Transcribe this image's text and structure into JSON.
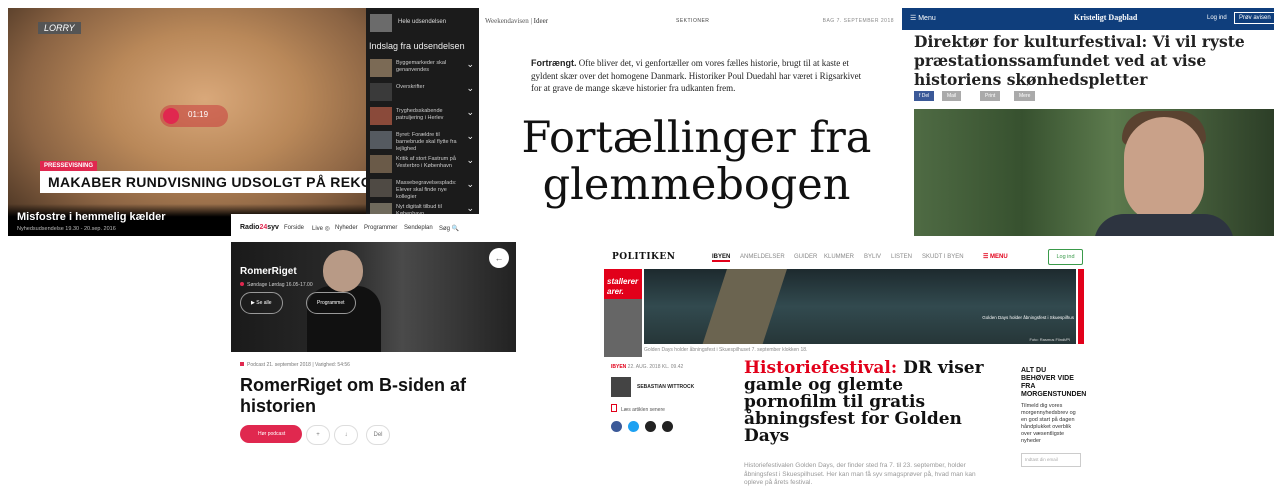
{
  "dr": {
    "logo": "LORRY",
    "time": "01:19",
    "kicker": "PRESSEVISNING",
    "headline": "MAKABER RUNDVISNING UDSOLGT PÅ REKORDTID",
    "video_title": "Misfostre i hemmelig kælder",
    "video_meta": "Nyhedsudsendelse 19.30 - 20.sep. 2016",
    "full_broadcast": "Hele udsendelsen",
    "section": "Indslag fra udsendelsen",
    "items": [
      {
        "label": "Byggemarkeder skal genanvendes",
        "color": "#7b6a55"
      },
      {
        "label": "Overskrifter",
        "color": "#3a3a3a"
      },
      {
        "label": "Trygheds­skabende patruljering i Herlev",
        "color": "#8a4a3a"
      },
      {
        "label": "Byret: Forældre til barnebrude skal flytte fra lejlighed",
        "color": "#555a60"
      },
      {
        "label": "Kritik af stort Fastrum på Vesterbro i København",
        "color": "#6a5a48"
      },
      {
        "label": "Massebegravelsesplads: Elever skal finde nye kollegier",
        "color": "#4f4a44"
      },
      {
        "label": "Nyt digitalt tilbud til København",
        "color": "#6f6a5c"
      }
    ]
  },
  "wa": {
    "brand": "Weekendavisen",
    "section_brand": "Ideer",
    "section": "SEKTIONER",
    "date": "BAG 7. SEPTEMBER 2018",
    "lead_bold": "Fortrængt.",
    "lead": " Ofte bliver det, vi genfortæller om vores fælles historie, brugt til at kaste et gyldent skær over det homogene Danmark. Historiker Poul Duedahl har været i Rigsarkivet for at grave de mange skæve historier fra udkanten frem.",
    "title_line1": "Fortællinger fra",
    "title_line2": "glemmebogen"
  },
  "kd": {
    "menu": "☰ Menu",
    "masthead": "Kristeligt Dagblad",
    "login": "Log ind",
    "subscribe": "Prøv avisen",
    "headline": "Direktør for kulturfestival: Vi vil ryste præstationssamfundet ved at vise historiens skønhedspletter",
    "share": [
      "f Del",
      "Mail",
      "Print",
      "Mere"
    ]
  },
  "r24": {
    "logo_a": "Radio",
    "logo_b": "24",
    "logo_c": "syv",
    "nav": [
      "Forside",
      "Live ◎",
      "Nyheder",
      "Programmer",
      "Sendeplan",
      "Søg 🔍"
    ],
    "show": "RomerRiget",
    "show_meta": "Søndage Lørdag 16.05-17.00",
    "btn_all": "▶  Se alle",
    "btn_program": "Programmet",
    "podcast_meta": "Podcast 21. september 2018 | Varighed: 54:56",
    "title": "RomerRiget om B-siden af historien",
    "play": "Hør podcast",
    "circ": [
      "+",
      "↓",
      "Del"
    ]
  },
  "pol": {
    "logo": "POLITIKEN",
    "nav": [
      "IBYEN",
      "ANMELDELSER",
      "GUIDER",
      "KLUMMER",
      "BYLIV",
      "LISTEN",
      "SKUDT I BYEN"
    ],
    "menu": "☰ MENU",
    "login": "Log ind",
    "red_text": "stallerer arer.",
    "photo_caption": "Golden Days holder åbningsfest i Skuespilhus",
    "photo_credit": "Foto: Rasmus Flindt/Pl",
    "caption_line": "Golden Days holder åbningsfest i Skuespilhuset 7. september klokken 18.",
    "date_tag": "IBYEN",
    "date": " 22. AUG. 2018 KL. 09.42",
    "author": "SEBASTIAN WITTROCK",
    "save": "Læs artiklen senere",
    "headline_red": "Historiefestival:",
    "headline": " DR viser gamle og glemte pornofilm til gratis åbningsfest for Golden Days",
    "body": "Historiefestivalen Golden Days, der finder sted fra 7. til 23. september, holder åbningsfest i Skuespilhuset. Her kan man få syv smagsprøver på, hvad man kan opleve på årets festival.",
    "aside_head": "ALT DU BEHØVER VIDE FRA MORGENSTUNDEN",
    "aside_text": "Tilmeld dig vores morgennyhedsbrev og en god start på dagen håndplukket overblik over væsentligste nyheder",
    "aside_input": "Indtast din email"
  }
}
